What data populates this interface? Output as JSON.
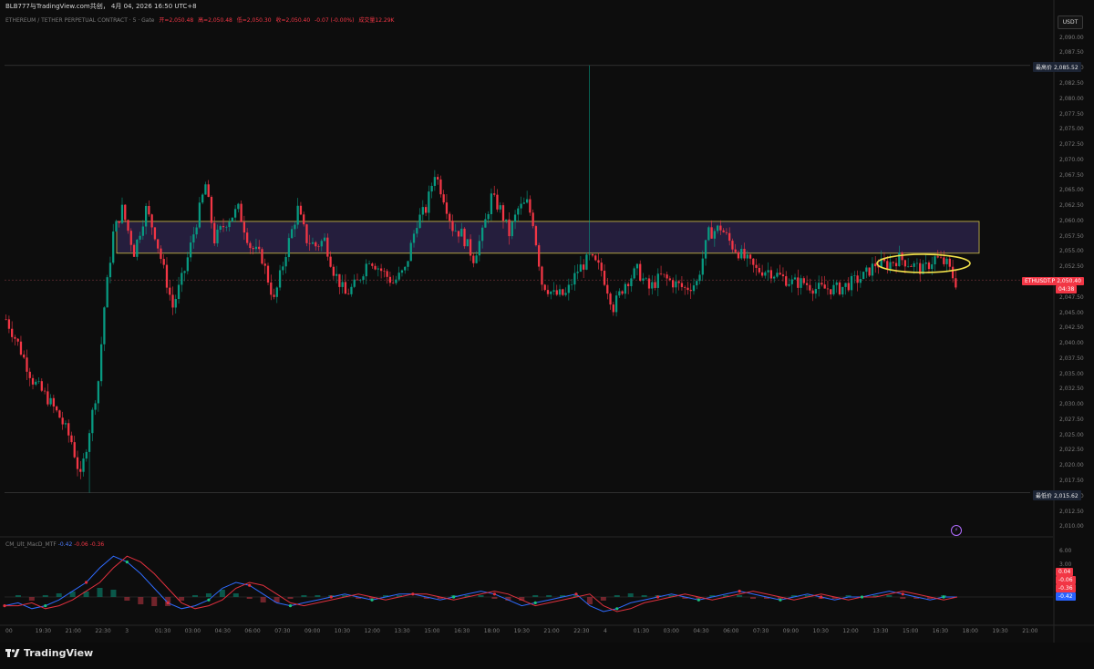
{
  "top_bar": "BLB777与TradingView.com共创， 4月 04, 2026 16:50 UTC+8",
  "legend": {
    "symbol": "ETHEREUM / TETHER PERPETUAL CONTRACT · 5 · Gate",
    "open": "开=2,050.48",
    "high": "高=2,050.48",
    "low": "低=2,050.30",
    "close": "收=2,050.40",
    "change": "-0.07 (-0.00%)",
    "volume": "成交量12.29K"
  },
  "currency_button": "USDT",
  "price_axis": {
    "ticks": [
      "2,090.00",
      "2,087.50",
      "2,085.00",
      "2,082.50",
      "2,080.00",
      "2,077.50",
      "2,075.00",
      "2,072.50",
      "2,070.00",
      "2,067.50",
      "2,065.00",
      "2,062.50",
      "2,060.00",
      "2,057.50",
      "2,055.00",
      "2,052.50",
      "2,050.00",
      "2,047.50",
      "2,045.00",
      "2,042.50",
      "2,040.00",
      "2,037.50",
      "2,035.00",
      "2,032.50",
      "2,030.00",
      "2,027.50",
      "2,025.00",
      "2,022.50",
      "2,020.00",
      "2,017.50",
      "2,015.00",
      "2,012.50",
      "2,010.00"
    ],
    "range": [
      2009,
      2091
    ]
  },
  "markers": {
    "high_label": "最高价",
    "high_value": "2,085.52",
    "high_price": 2085.52,
    "low_label": "最低价",
    "low_value": "2,015.62",
    "low_price": 2015.62,
    "current_symbol": "ETHUSDT.P",
    "current_value": "2,050.40",
    "current_price": 2050.4,
    "countdown": "04:38"
  },
  "zone": {
    "top": 2060.0,
    "bottom": 2054.8,
    "color": "#2a2246",
    "border": "#d4c24a"
  },
  "indicator": {
    "legend_name": "CM_Ult_MacD_MTF",
    "v1": "-0.42",
    "v2": "-0.06",
    "v3": "-0.36",
    "axis_ticks": [
      "6.00",
      "3.00"
    ],
    "tags": [
      {
        "text": "0.04",
        "color": "#f23645"
      },
      {
        "text": "-0.06",
        "color": "#f23645"
      },
      {
        "text": "-0.36",
        "color": "#f23645"
      },
      {
        "text": "-0.42",
        "color": "#2962ff"
      }
    ]
  },
  "time_axis": [
    "00",
    "19:30",
    "21:00",
    "22:30",
    "3",
    "01:30",
    "03:00",
    "04:30",
    "06:00",
    "07:30",
    "09:00",
    "10:30",
    "12:00",
    "13:30",
    "15:00",
    "16:30",
    "18:00",
    "19:30",
    "21:00",
    "22:30",
    "4",
    "01:30",
    "03:00",
    "04:30",
    "06:00",
    "07:30",
    "09:00",
    "10:30",
    "12:00",
    "13:30",
    "15:00",
    "16:30",
    "18:00",
    "19:30",
    "21:00"
  ],
  "footer_brand": "TradingView",
  "colors": {
    "up": "#089981",
    "down": "#f23645",
    "background": "#0d0d0d"
  },
  "chart_data": {
    "type": "candlestick",
    "ylim": [
      2009,
      2091
    ],
    "path": [
      [
        0,
        2044
      ],
      [
        4,
        2040
      ],
      [
        9,
        2034
      ],
      [
        14,
        2031
      ],
      [
        18,
        2028
      ],
      [
        22,
        2024
      ],
      [
        25,
        2018
      ],
      [
        28,
        2026
      ],
      [
        31,
        2034
      ],
      [
        33,
        2046
      ],
      [
        36,
        2058
      ],
      [
        39,
        2062
      ],
      [
        43,
        2055
      ],
      [
        47,
        2062
      ],
      [
        50,
        2058
      ],
      [
        53,
        2052
      ],
      [
        56,
        2046
      ],
      [
        60,
        2052
      ],
      [
        64,
        2060
      ],
      [
        67,
        2066
      ],
      [
        70,
        2057
      ],
      [
        74,
        2060
      ],
      [
        78,
        2062
      ],
      [
        82,
        2056
      ],
      [
        86,
        2054
      ],
      [
        90,
        2047
      ],
      [
        94,
        2055
      ],
      [
        98,
        2062
      ],
      [
        101,
        2057
      ],
      [
        104,
        2056
      ],
      [
        107,
        2057
      ],
      [
        110,
        2052
      ],
      [
        114,
        2048
      ],
      [
        118,
        2050
      ],
      [
        122,
        2054
      ],
      [
        126,
        2052
      ],
      [
        130,
        2050
      ],
      [
        134,
        2052
      ],
      [
        138,
        2060
      ],
      [
        141,
        2062
      ],
      [
        144,
        2068
      ],
      [
        147,
        2064
      ],
      [
        150,
        2059
      ],
      [
        153,
        2058
      ],
      [
        157,
        2054
      ],
      [
        160,
        2058
      ],
      [
        163,
        2064
      ],
      [
        166,
        2062
      ],
      [
        169,
        2058
      ],
      [
        172,
        2062
      ],
      [
        175,
        2063
      ],
      [
        177,
        2060
      ],
      [
        180,
        2050
      ],
      [
        184,
        2048
      ],
      [
        188,
        2048
      ],
      [
        192,
        2052
      ],
      [
        196,
        2054
      ],
      [
        200,
        2052
      ],
      [
        204,
        2046
      ],
      [
        208,
        2050
      ],
      [
        212,
        2052
      ],
      [
        216,
        2049
      ],
      [
        220,
        2051
      ],
      [
        224,
        2050
      ],
      [
        228,
        2049
      ],
      [
        232,
        2050
      ],
      [
        236,
        2058
      ],
      [
        240,
        2059
      ],
      [
        244,
        2056
      ],
      [
        248,
        2054
      ],
      [
        252,
        2052
      ],
      [
        256,
        2052
      ],
      [
        260,
        2051
      ],
      [
        264,
        2050
      ],
      [
        268,
        2050
      ],
      [
        272,
        2049
      ],
      [
        276,
        2049
      ],
      [
        280,
        2049
      ],
      [
        284,
        2050
      ],
      [
        288,
        2051
      ],
      [
        292,
        2053
      ],
      [
        296,
        2053
      ],
      [
        300,
        2054
      ],
      [
        304,
        2053
      ],
      [
        308,
        2052
      ],
      [
        312,
        2054
      ],
      [
        316,
        2053
      ],
      [
        319,
        2050
      ]
    ]
  }
}
